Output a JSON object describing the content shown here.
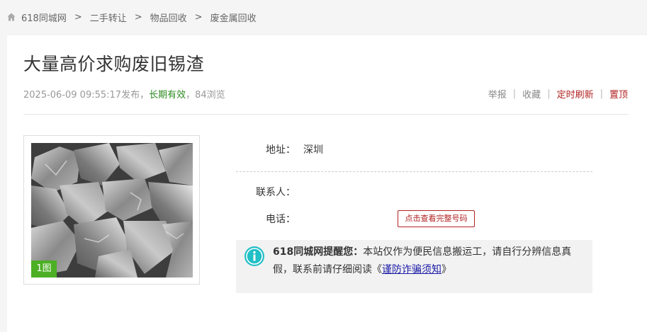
{
  "breadcrumb": {
    "items": [
      "618同城网",
      "二手转让",
      "物品回收",
      "废金属回收"
    ],
    "separator": ">"
  },
  "listing": {
    "title": "大量高价求购废旧锡渣",
    "date": "2025-06-09 09:55:17发布",
    "comma1": "，",
    "validity": "长期有效",
    "comma2": "，",
    "views": "84浏览"
  },
  "actions": {
    "report": "举报",
    "favorite": "收藏",
    "refresh": "定时刷新",
    "top": "置顶",
    "separator": "|"
  },
  "photo": {
    "count": "1图"
  },
  "details": {
    "address_label": "地址：",
    "address_value": "深圳",
    "contact_label": "联系人：",
    "phone_label": "电话：",
    "phone_button": "点击查看完整号码"
  },
  "notice": {
    "brand": "618同城网提醒您：",
    "body": "本站仅作为便民信息搬运工，请自行分辨信息真假，联系前请仔细阅读",
    "link_open": "《",
    "link": "谨防诈骗须知",
    "link_close": "》"
  },
  "colors": {
    "valid_green": "#2e8b22",
    "accent_red": "#b22222",
    "info_teal": "#21bfc6",
    "badge_green": "#4caf24"
  }
}
